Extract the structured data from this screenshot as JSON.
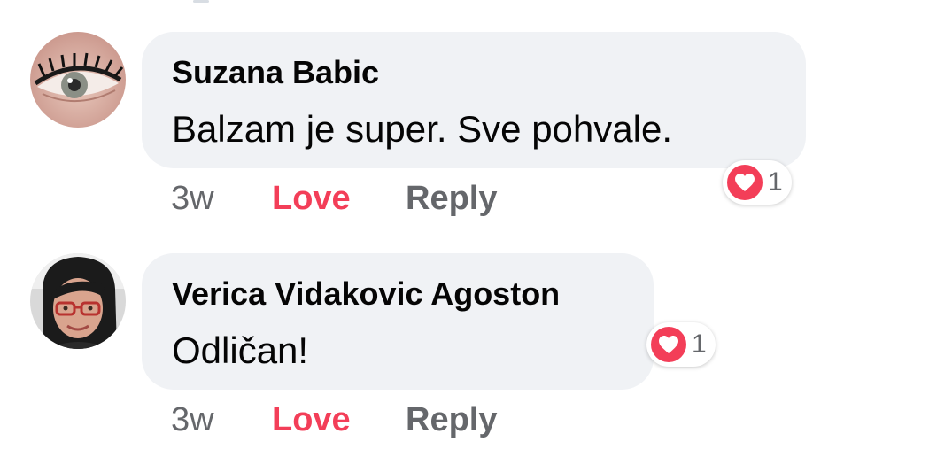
{
  "comments": [
    {
      "author": "Suzana Babic",
      "text": "Balzam je super. Sve pohvale.",
      "time": "3w",
      "love_label": "Love",
      "reply_label": "Reply",
      "reaction_icon": "heart-icon",
      "reaction_count": "1",
      "avatar_icon": "eye-avatar"
    },
    {
      "author": "Verica Vidakovic Agoston",
      "text": "Odličan!",
      "time": "3w",
      "love_label": "Love",
      "reply_label": "Reply",
      "reaction_icon": "heart-icon",
      "reaction_count": "1",
      "avatar_icon": "woman-with-glasses-avatar"
    }
  ],
  "colors": {
    "love": "#f33e58",
    "bubble": "#f0f2f5",
    "meta": "#65676b",
    "text": "#050505"
  }
}
